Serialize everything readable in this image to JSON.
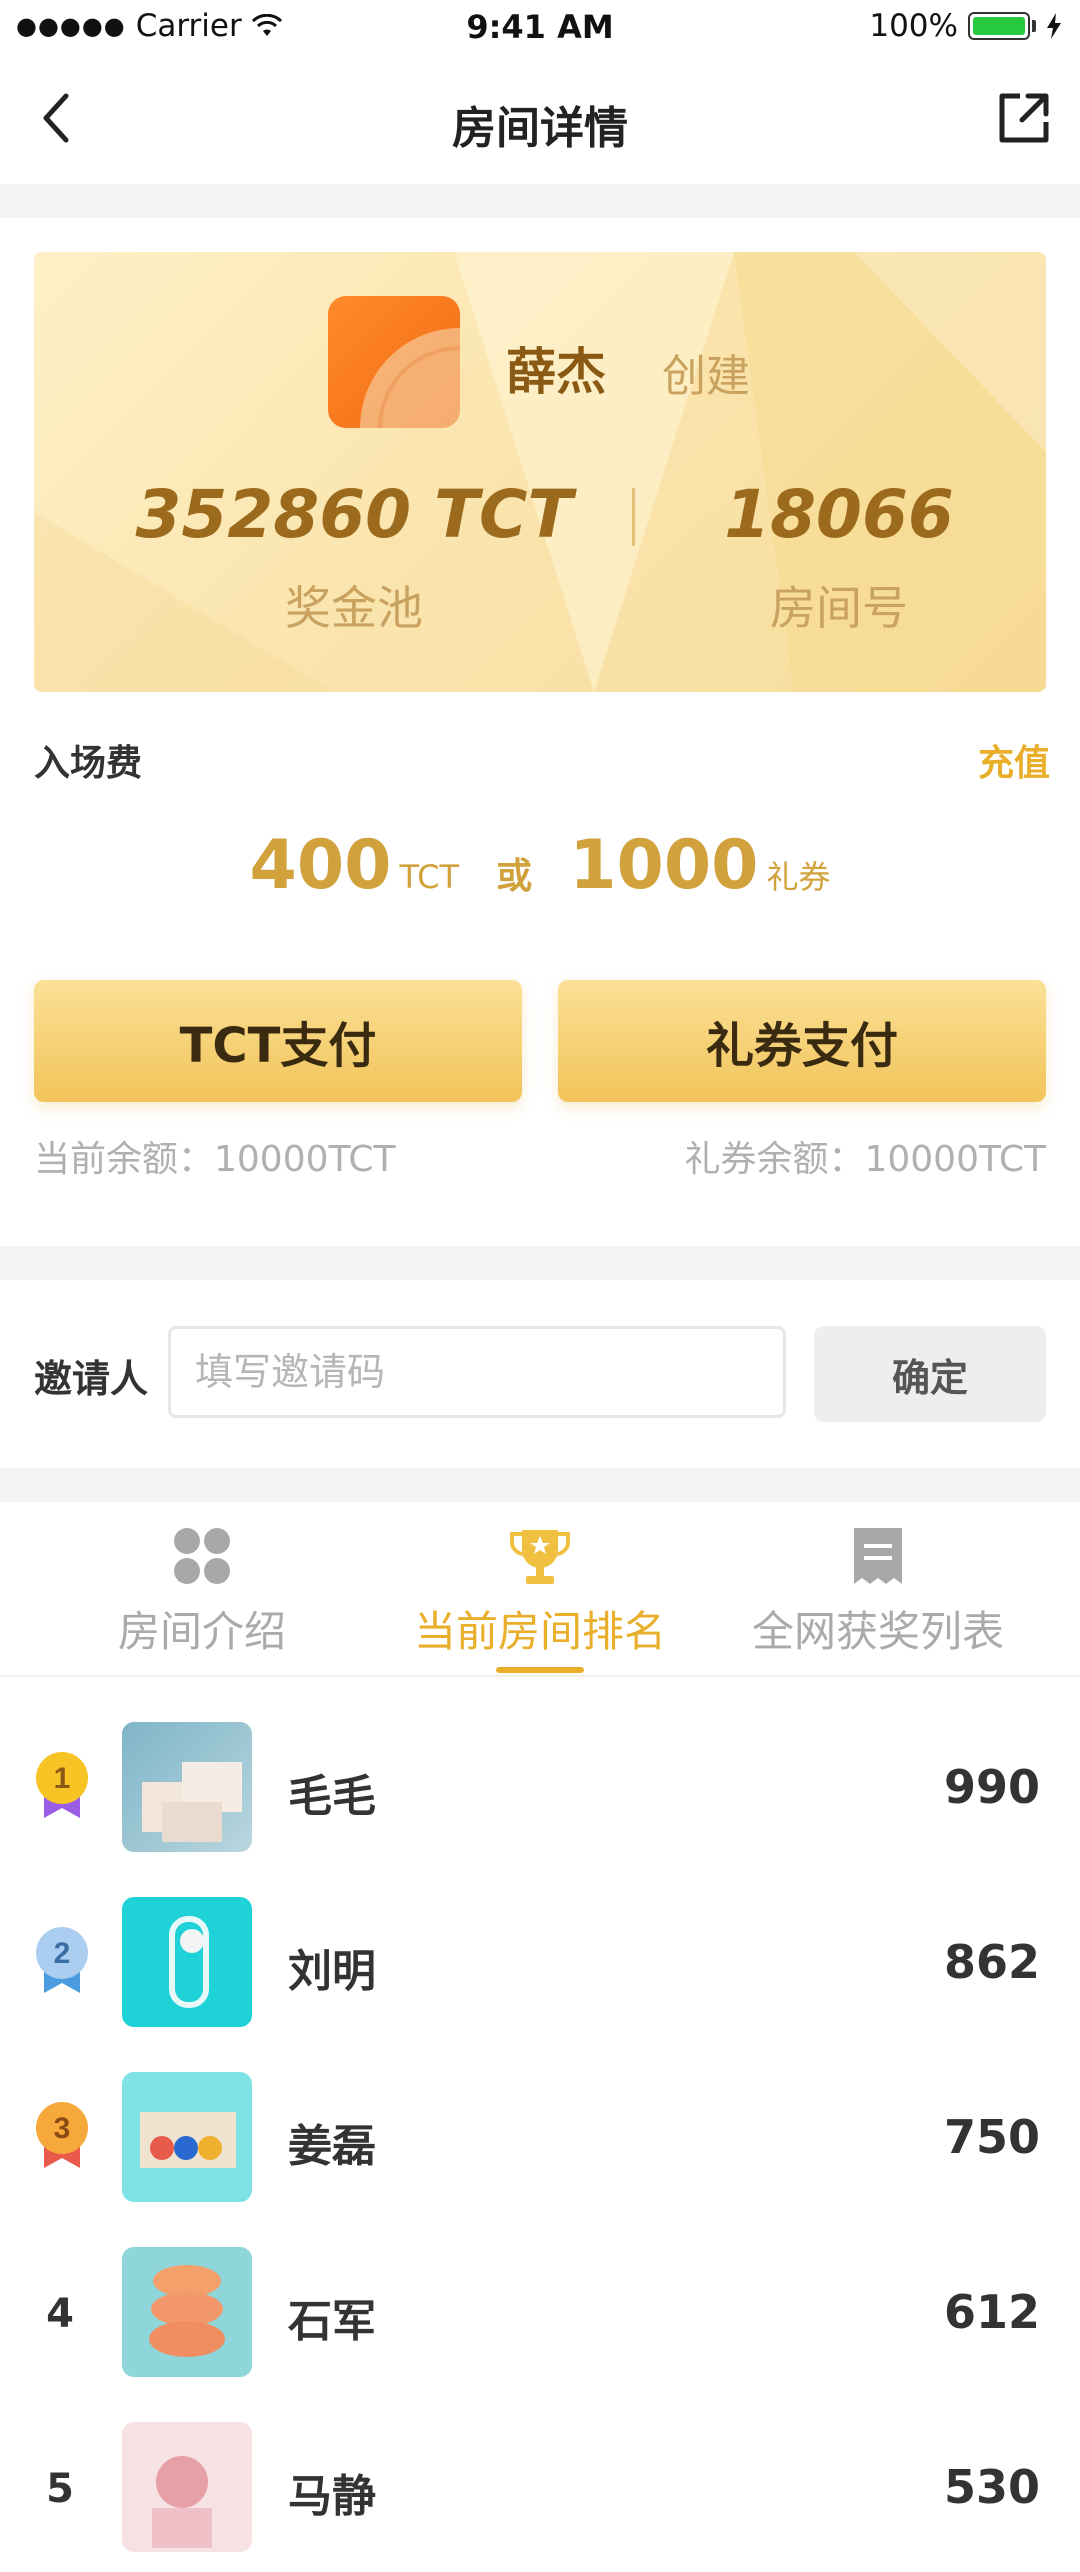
{
  "status_bar": {
    "carrier": "Carrier",
    "time": "9:41 AM",
    "battery": "100%"
  },
  "nav": {
    "title": "房间详情"
  },
  "banner": {
    "creator_name": "薛杰",
    "creator_tag": "创建",
    "pool_value": "352860 TCT",
    "pool_label": "奖金池",
    "room_value": "18066",
    "room_label": "房间号"
  },
  "fee": {
    "label": "入场费",
    "recharge": "充值",
    "tct_amount": "400",
    "tct_unit": "TCT",
    "or_text": "或",
    "coupon_amount": "1000",
    "coupon_unit": "礼券"
  },
  "pay": {
    "tct_button": "TCT支付",
    "coupon_button": "礼券支付",
    "tct_balance": "当前余额：10000TCT",
    "coupon_balance": "礼券余额：10000TCT"
  },
  "invite": {
    "label": "邀请人",
    "placeholder": "填写邀请码",
    "value": "",
    "confirm": "确定"
  },
  "tabs": [
    {
      "label": "房间介绍",
      "icon": "grid-icon",
      "active": false
    },
    {
      "label": "当前房间排名",
      "icon": "trophy-icon",
      "active": true
    },
    {
      "label": "全网获奖列表",
      "icon": "receipt-icon",
      "active": false
    }
  ],
  "ranking": [
    {
      "rank": "1",
      "name": "毛毛",
      "score": "990"
    },
    {
      "rank": "2",
      "name": "刘明",
      "score": "862"
    },
    {
      "rank": "3",
      "name": "姜磊",
      "score": "750"
    },
    {
      "rank": "4",
      "name": "石军",
      "score": "612"
    },
    {
      "rank": "5",
      "name": "马静",
      "score": "530"
    }
  ],
  "colors": {
    "accent": "#e9ae2a",
    "gold_text": "#9b6a1d",
    "tab_inactive": "#aaaaaa"
  }
}
